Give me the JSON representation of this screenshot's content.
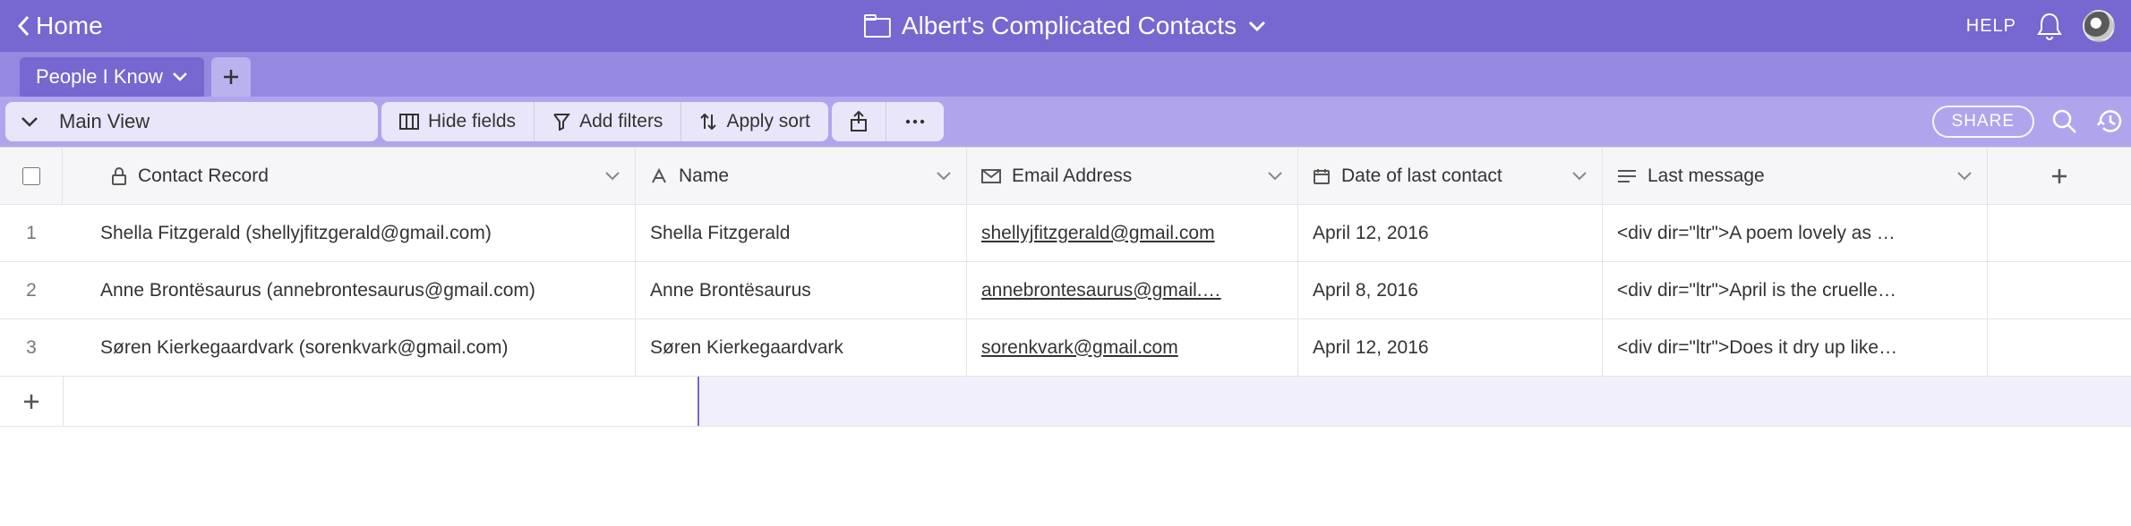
{
  "header": {
    "home_label": "Home",
    "title": "Albert's Complicated Contacts",
    "help_label": "HELP"
  },
  "tabs": {
    "active_label": "People I Know"
  },
  "toolbar": {
    "view_label": "Main View",
    "hide_fields": "Hide fields",
    "add_filters": "Add filters",
    "apply_sort": "Apply sort",
    "share": "SHARE"
  },
  "columns": {
    "record": "Contact Record",
    "name": "Name",
    "email": "Email Address",
    "date": "Date of last contact",
    "msg": "Last message"
  },
  "rows": [
    {
      "num": "1",
      "record": "Shella Fitzgerald (shellyjfitzgerald@gmail.com)",
      "name": "Shella Fitzgerald",
      "email": "shellyjfitzgerald@gmail.com",
      "date": "April 12, 2016",
      "msg": "<div dir=\"ltr\">A poem lovely as …"
    },
    {
      "num": "2",
      "record": "Anne Brontësaurus (annebrontesaurus@gmail.com)",
      "name": "Anne Brontësaurus",
      "email": "annebrontesaurus@gmail.…",
      "date": "April 8, 2016",
      "msg": "<div dir=\"ltr\">April is the cruelle…"
    },
    {
      "num": "3",
      "record": "Søren Kierkegaardvark (sorenkvark@gmail.com)",
      "name": "Søren Kierkegaardvark",
      "email": "sorenkvark@gmail.com",
      "date": "April 12, 2016",
      "msg": "<div dir=\"ltr\">Does it dry up like…"
    }
  ]
}
